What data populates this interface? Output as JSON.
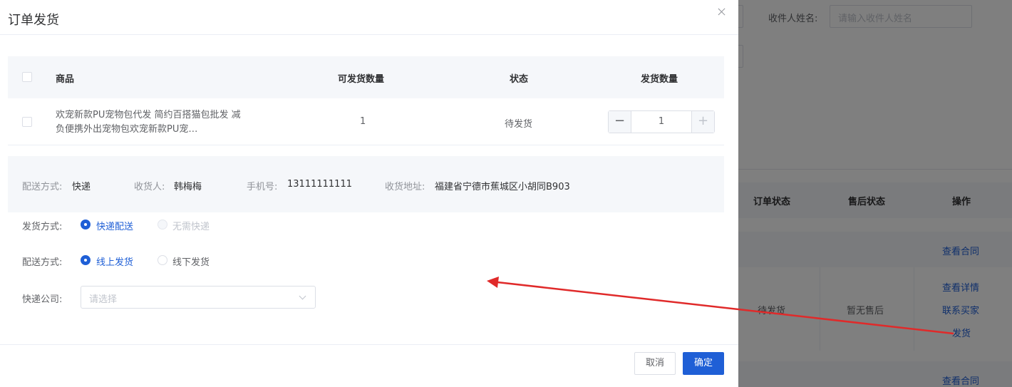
{
  "background": {
    "recipient_label": "收件人姓名:",
    "recipient_placeholder": "请输入收件人姓名",
    "columns": [
      "订单状态",
      "售后状态",
      "操作"
    ],
    "row1_action": "查看合同",
    "row2": {
      "order_status": "待发货",
      "after_sale": "暂无售后",
      "actions": [
        "查看详情",
        "联系买家",
        "发货"
      ]
    },
    "row3_action": "查看合同"
  },
  "dialog": {
    "title": "订单发货",
    "table": {
      "headers": [
        "商品",
        "可发货数量",
        "状态",
        "发货数量"
      ],
      "rows": [
        {
          "product": "欢宠新款PU宠物包代发 简约百搭猫包批发 减负便携外出宠物包欢宠新款PU宠…",
          "available_qty": "1",
          "status": "待发货",
          "ship_qty": "1"
        }
      ]
    },
    "info": {
      "delivery_label": "配送方式:",
      "delivery_value": "快递",
      "receiver_label": "收货人:",
      "receiver_value": "韩梅梅",
      "phone_label": "手机号:",
      "phone_value": "13111111111",
      "address_label": "收货地址:",
      "address_value": "福建省宁德市蕉城区小胡同B903"
    },
    "form": {
      "ship_method_label": "发货方式:",
      "ship_method_options": [
        "快递配送",
        "无需快递"
      ],
      "ship_method_selected": "快递配送",
      "delivery_mode_label": "配送方式:",
      "delivery_mode_options": [
        "线上发货",
        "线下发货"
      ],
      "delivery_mode_selected": "线上发货",
      "courier_label": "快递公司:",
      "courier_placeholder": "请选择"
    },
    "buttons": {
      "cancel": "取消",
      "confirm": "确定"
    }
  },
  "colors": {
    "primary": "#1f5fd6",
    "annotation_arrow": "#e02a2a",
    "overlay": "rgba(0,0,0,0.5)"
  }
}
